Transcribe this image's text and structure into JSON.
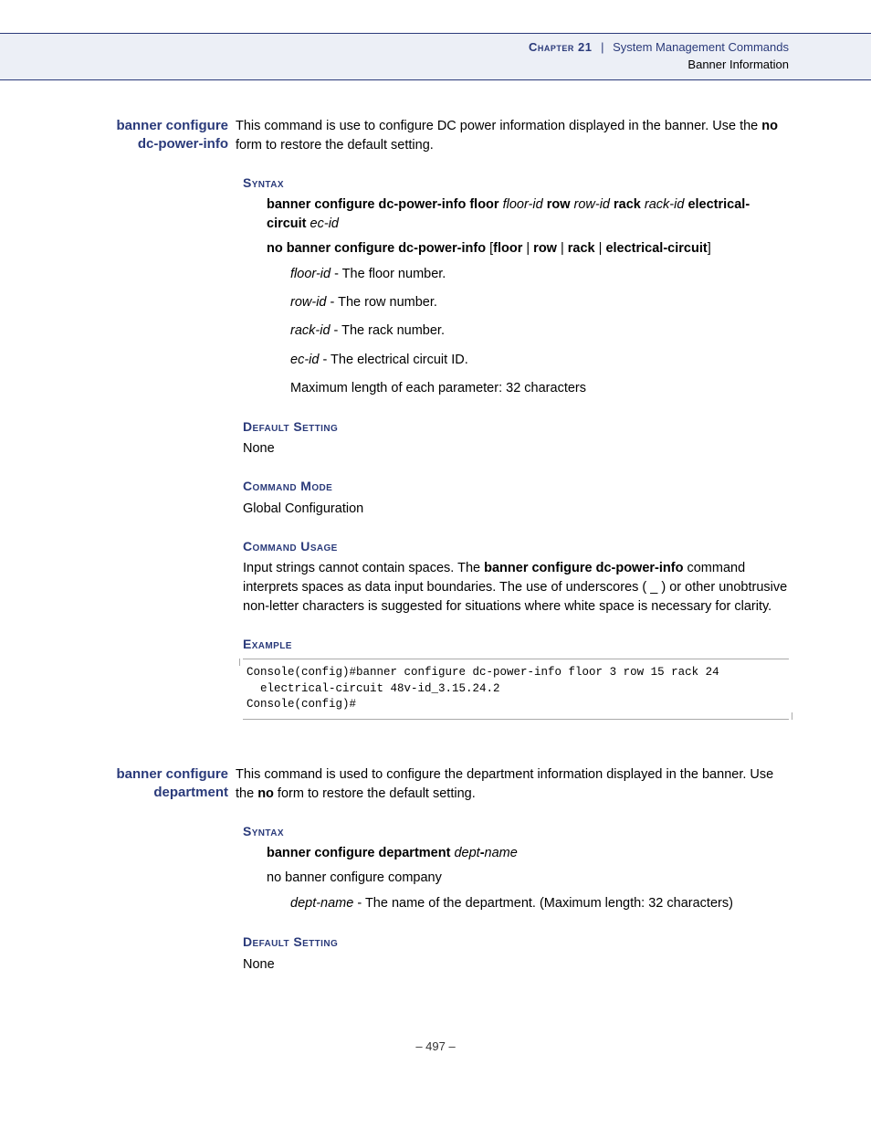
{
  "header": {
    "chapter_label": "Chapter 21",
    "pipe": "|",
    "chapter_title": "System Management Commands",
    "subtitle": "Banner Information"
  },
  "cmd1": {
    "name_line1": "banner configure",
    "name_line2": "dc-power-info",
    "desc_part1": "This command is use to configure DC power information displayed in the banner. Use the ",
    "desc_bold": "no",
    "desc_part2": " form to restore the default setting.",
    "syntax_heading": "Syntax",
    "syntax1": {
      "p1": "banner configure dc-power-info floor",
      "i1": "floor-id",
      "p2": "row",
      "i2": "row-id",
      "p3": "rack",
      "i3": "rack-id",
      "p4": "electrical-circuit",
      "i4": "ec-id"
    },
    "syntax2": {
      "p1": "no banner configure dc-power-info",
      "br": "[",
      "w1": "floor",
      "bar": " | ",
      "w2": "row",
      "w3": "rack",
      "w4": "electrical-circuit",
      "close": "]"
    },
    "param1_i": "floor-id",
    "param1_t": " - The floor number.",
    "param2_i": "row-id",
    "param2_t": " - The row number.",
    "param3_i": "rack-id",
    "param3_t": " - The rack number.",
    "param4_i": "ec-id",
    "param4_t": " - The electrical circuit ID.",
    "param5": "Maximum length of each parameter: 32 characters",
    "default_heading": "Default Setting",
    "default_value": "None",
    "mode_heading": "Command Mode",
    "mode_value": "Global Configuration",
    "usage_heading": "Command Usage",
    "usage_p1": "Input strings cannot contain spaces. The ",
    "usage_b": "banner configure dc-power-info",
    "usage_p2": " command interprets spaces as data input boundaries. The use of underscores ( _ ) or other unobtrusive non-letter characters is suggested for situations where white space is necessary for clarity.",
    "example_heading": "Example",
    "example_code": "Console(config)#banner configure dc-power-info floor 3 row 15 rack 24 \n  electrical-circuit 48v-id_3.15.24.2\nConsole(config)#"
  },
  "cmd2": {
    "name_line1": "banner configure",
    "name_line2": "department",
    "desc_part1": "This command is used to configure the department information displayed in the banner. Use the ",
    "desc_bold": "no",
    "desc_part2": " form to restore the default setting.",
    "syntax_heading": "Syntax",
    "syntax1_b": "banner configure department",
    "syntax1_i": "dept",
    "syntax1_dash": "-",
    "syntax1_i2": "name",
    "syntax2": "no banner configure company",
    "param1_i": "dept-name",
    "param1_t": " - The name of the department. (Maximum length: 32 characters)",
    "default_heading": "Default Setting",
    "default_value": "None"
  },
  "footer": {
    "page": "–  497  –"
  }
}
